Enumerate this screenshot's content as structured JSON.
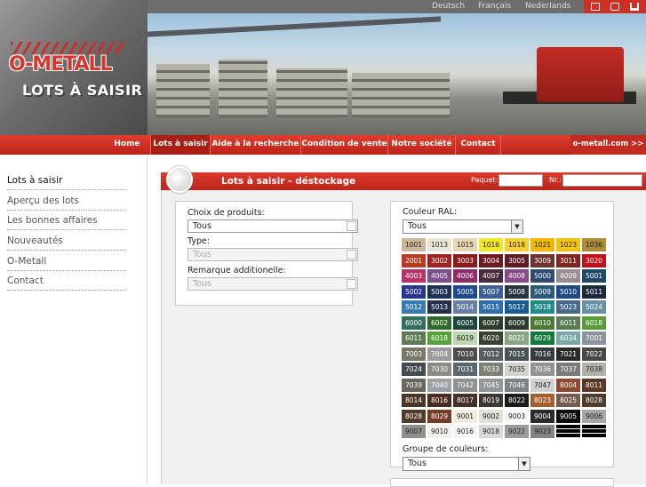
{
  "brand": {
    "logo": "O-METALL",
    "tagline": "LOTS À SAISIR"
  },
  "languages": [
    "Deutsch",
    "Français",
    "Nederlands"
  ],
  "topnav": [
    {
      "label": "Home"
    },
    {
      "label": "Lots à saisir"
    },
    {
      "label": "Aide à la recherche"
    },
    {
      "label": "Condition de vente"
    },
    {
      "label": "Notre société"
    },
    {
      "label": "Contact"
    },
    {
      "label": "o-metall.com >>"
    }
  ],
  "sidebar": [
    {
      "label": "Lots à saisir"
    },
    {
      "label": "Aperçu des lots"
    },
    {
      "label": "Les bonnes affaires"
    },
    {
      "label": "Nouveautés"
    },
    {
      "label": "O-Metall"
    },
    {
      "label": "Contact"
    }
  ],
  "panel": {
    "title": "Lots à saisir - déstockage",
    "paquet_label": "Paquet:",
    "nr_label": "Nr.:"
  },
  "filters": {
    "product_label": "Choix de produits:",
    "product_value": "Tous",
    "type_label": "Type:",
    "type_value": "Tous",
    "remark_label": "Remarque additionelle:",
    "remark_value": "Tous"
  },
  "ral": {
    "label": "Couleur RAL:",
    "value": "Tous",
    "group_label": "Groupe de couleurs:",
    "group_value": "Tous",
    "swatches": [
      {
        "code": "1001",
        "color": "#cdb79a",
        "text": "#222"
      },
      {
        "code": "1013",
        "color": "#eae6d6",
        "text": "#222"
      },
      {
        "code": "1015",
        "color": "#e6d6b4",
        "text": "#222"
      },
      {
        "code": "1016",
        "color": "#efe829",
        "text": "#222"
      },
      {
        "code": "1018",
        "color": "#f5d033",
        "text": "#222"
      },
      {
        "code": "1021",
        "color": "#f2b700",
        "text": "#222"
      },
      {
        "code": "1023",
        "color": "#f4c210",
        "text": "#222"
      },
      {
        "code": "1036",
        "color": "#ad8b38",
        "text": "#222"
      },
      {
        "code": "2001",
        "color": "#b83c23",
        "text": "#fff"
      },
      {
        "code": "3002",
        "color": "#a02422",
        "text": "#fff"
      },
      {
        "code": "3003",
        "color": "#8b1a1f",
        "text": "#fff"
      },
      {
        "code": "3004",
        "color": "#6c1b24",
        "text": "#fff"
      },
      {
        "code": "3005",
        "color": "#5e1d26",
        "text": "#fff"
      },
      {
        "code": "3009",
        "color": "#6e342e",
        "text": "#fff"
      },
      {
        "code": "3011",
        "color": "#7f2620",
        "text": "#fff"
      },
      {
        "code": "3020",
        "color": "#c1121c",
        "text": "#fff"
      },
      {
        "code": "4003",
        "color": "#b6336a",
        "text": "#fff"
      },
      {
        "code": "4005",
        "color": "#7a4f8c",
        "text": "#fff"
      },
      {
        "code": "4006",
        "color": "#8e2c6e",
        "text": "#fff"
      },
      {
        "code": "4007",
        "color": "#4a2b3c",
        "text": "#fff"
      },
      {
        "code": "4008",
        "color": "#884a86",
        "text": "#fff"
      },
      {
        "code": "5000",
        "color": "#304a74",
        "text": "#fff"
      },
      {
        "code": "4009",
        "color": "#9c8c96",
        "text": "#fff"
      },
      {
        "code": "5001",
        "color": "#1f4766",
        "text": "#fff"
      },
      {
        "code": "5002",
        "color": "#27378e",
        "text": "#fff"
      },
      {
        "code": "5003",
        "color": "#1e3258",
        "text": "#fff"
      },
      {
        "code": "5005",
        "color": "#1e4b8a",
        "text": "#fff"
      },
      {
        "code": "5007",
        "color": "#3f6090",
        "text": "#fff"
      },
      {
        "code": "5008",
        "color": "#2a3540",
        "text": "#fff"
      },
      {
        "code": "5009",
        "color": "#2e5a7a",
        "text": "#fff"
      },
      {
        "code": "5010",
        "color": "#1f4a82",
        "text": "#fff"
      },
      {
        "code": "5011",
        "color": "#1c2a3c",
        "text": "#fff"
      },
      {
        "code": "5012",
        "color": "#3a7bb5",
        "text": "#fff"
      },
      {
        "code": "5013",
        "color": "#25304e",
        "text": "#fff"
      },
      {
        "code": "5014",
        "color": "#6681a4",
        "text": "#fff"
      },
      {
        "code": "5015",
        "color": "#2e6fad",
        "text": "#fff"
      },
      {
        "code": "5017",
        "color": "#1c5a93",
        "text": "#fff"
      },
      {
        "code": "5018",
        "color": "#218b8b",
        "text": "#fff"
      },
      {
        "code": "5023",
        "color": "#476a8b",
        "text": "#fff"
      },
      {
        "code": "5024",
        "color": "#6890a6",
        "text": "#fff"
      },
      {
        "code": "6000",
        "color": "#33705d",
        "text": "#fff"
      },
      {
        "code": "6002",
        "color": "#316b2c",
        "text": "#fff"
      },
      {
        "code": "6005",
        "color": "#1f463b",
        "text": "#fff"
      },
      {
        "code": "6007",
        "color": "#2b3e2c",
        "text": "#fff"
      },
      {
        "code": "6009",
        "color": "#2b3b30",
        "text": "#fff"
      },
      {
        "code": "6010",
        "color": "#4b7a34",
        "text": "#fff"
      },
      {
        "code": "6011",
        "color": "#5a7c55",
        "text": "#fff"
      },
      {
        "code": "6018",
        "color": "#5a9c3a",
        "text": "#fff"
      },
      {
        "code": "6011",
        "color": "#5d7c53",
        "text": "#fff"
      },
      {
        "code": "6018",
        "color": "#58a23c",
        "text": "#fff"
      },
      {
        "code": "6019",
        "color": "#bed8b3",
        "text": "#222"
      },
      {
        "code": "6020",
        "color": "#37422f",
        "text": "#fff"
      },
      {
        "code": "6021",
        "color": "#88a683",
        "text": "#fff"
      },
      {
        "code": "6029",
        "color": "#137a3b",
        "text": "#fff"
      },
      {
        "code": "6034",
        "color": "#7ba9aa",
        "text": "#fff"
      },
      {
        "code": "7001",
        "color": "#8a959d",
        "text": "#fff"
      },
      {
        "code": "7003",
        "color": "#7a7769",
        "text": "#fff"
      },
      {
        "code": "7004",
        "color": "#9c9c9c",
        "text": "#fff"
      },
      {
        "code": "7010",
        "color": "#4b4d48",
        "text": "#fff"
      },
      {
        "code": "7012",
        "color": "#565e63",
        "text": "#fff"
      },
      {
        "code": "7015",
        "color": "#4c5157",
        "text": "#fff"
      },
      {
        "code": "7016",
        "color": "#363c42",
        "text": "#fff"
      },
      {
        "code": "7021",
        "color": "#292b2e",
        "text": "#fff"
      },
      {
        "code": "7022",
        "color": "#4a4845",
        "text": "#fff"
      },
      {
        "code": "7024",
        "color": "#434a50",
        "text": "#fff"
      },
      {
        "code": "7030",
        "color": "#8c8a82",
        "text": "#fff"
      },
      {
        "code": "7031",
        "color": "#5b666c",
        "text": "#fff"
      },
      {
        "code": "7033",
        "color": "#7c8176",
        "text": "#fff"
      },
      {
        "code": "7035",
        "color": "#cfd2cf",
        "text": "#222"
      },
      {
        "code": "7036",
        "color": "#949292",
        "text": "#fff"
      },
      {
        "code": "7037",
        "color": "#797b7b",
        "text": "#fff"
      },
      {
        "code": "7038",
        "color": "#b0b2aa",
        "text": "#222"
      },
      {
        "code": "7039",
        "color": "#6b675f",
        "text": "#fff"
      },
      {
        "code": "7040",
        "color": "#9ba1a5",
        "text": "#fff"
      },
      {
        "code": "7042",
        "color": "#8e9292",
        "text": "#fff"
      },
      {
        "code": "7045",
        "color": "#90969a",
        "text": "#fff"
      },
      {
        "code": "7046",
        "color": "#7c8387",
        "text": "#fff"
      },
      {
        "code": "7047",
        "color": "#d0d0d0",
        "text": "#222"
      },
      {
        "code": "8004",
        "color": "#8d4931",
        "text": "#fff"
      },
      {
        "code": "8011",
        "color": "#5b3826",
        "text": "#fff"
      },
      {
        "code": "8014",
        "color": "#4b3524",
        "text": "#fff"
      },
      {
        "code": "8016",
        "color": "#4a2b1f",
        "text": "#fff"
      },
      {
        "code": "8017",
        "color": "#44302a",
        "text": "#fff"
      },
      {
        "code": "8019",
        "color": "#3d3635",
        "text": "#fff"
      },
      {
        "code": "8022",
        "color": "#1c1b1b",
        "text": "#fff"
      },
      {
        "code": "8023",
        "color": "#a65e2f",
        "text": "#fff"
      },
      {
        "code": "8025",
        "color": "#765c4c",
        "text": "#fff"
      },
      {
        "code": "8028",
        "color": "#4e3b2b",
        "text": "#fff"
      },
      {
        "code": "8028",
        "color": "#4f3a2c",
        "text": "#fff"
      },
      {
        "code": "8029",
        "color": "#773c27",
        "text": "#fff"
      },
      {
        "code": "9001",
        "color": "#f2ecdf",
        "text": "#222"
      },
      {
        "code": "9002",
        "color": "#e2e1d8",
        "text": "#222"
      },
      {
        "code": "9003",
        "color": "#f6f6f6",
        "text": "#222"
      },
      {
        "code": "9004",
        "color": "#2b2b2c",
        "text": "#fff"
      },
      {
        "code": "9005",
        "color": "#0e0e10",
        "text": "#fff"
      },
      {
        "code": "9006",
        "color": "#a5a8a6",
        "text": "#222"
      },
      {
        "code": "9007",
        "color": "#8f8f8c",
        "text": "#222"
      },
      {
        "code": "9010",
        "color": "#f4f2e8",
        "text": "#222"
      },
      {
        "code": "9016",
        "color": "#f6f6f6",
        "text": "#222"
      },
      {
        "code": "9018",
        "color": "#d7dbd5",
        "text": "#222"
      },
      {
        "code": "9022",
        "color": "#9c9c9c",
        "text": "#222"
      },
      {
        "code": "9023",
        "color": "#828383",
        "text": "#222"
      },
      {
        "code": "",
        "color": "#000000",
        "text": "#fff"
      },
      {
        "code": "",
        "color": "#000000",
        "text": "#fff"
      }
    ]
  },
  "colors": {
    "brand_red": "#cf3023",
    "nav_active": "#a81f15",
    "panel_bg": "#f0f0f0"
  }
}
